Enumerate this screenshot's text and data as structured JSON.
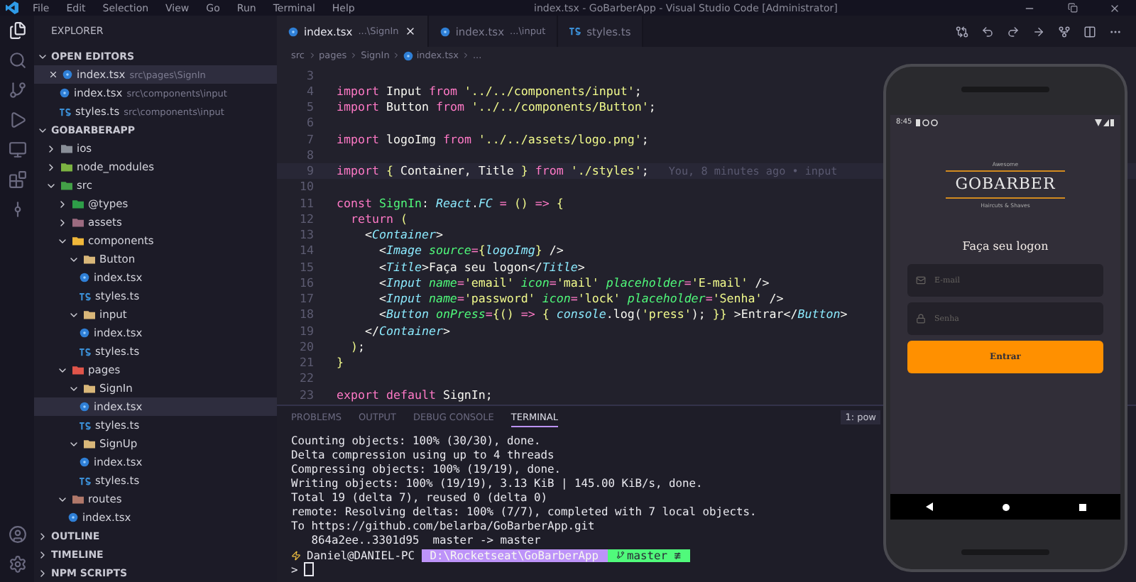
{
  "title_bar": {
    "menu": [
      "File",
      "Edit",
      "Selection",
      "View",
      "Go",
      "Run",
      "Terminal",
      "Help"
    ],
    "title": "index.tsx - GoBarberApp - Visual Studio Code [Administrator]"
  },
  "activity_bar": {
    "items": [
      {
        "kind": "files",
        "selected": true
      },
      {
        "kind": "search",
        "selected": false
      },
      {
        "kind": "scm",
        "selected": false
      },
      {
        "kind": "run",
        "selected": false
      },
      {
        "kind": "remote",
        "selected": false
      },
      {
        "kind": "extensions",
        "selected": false
      },
      {
        "kind": "git",
        "selected": false
      }
    ],
    "bottom": [
      {
        "kind": "account"
      },
      {
        "kind": "settings"
      }
    ]
  },
  "sidebar": {
    "title": "EXPLORER",
    "open_editors": {
      "title": "OPEN EDITORS",
      "expanded": true,
      "items": [
        {
          "name": "index.tsx",
          "path": "src\\pages\\SignIn",
          "kind": "react",
          "selected": true
        },
        {
          "name": "index.tsx",
          "path": "src\\components\\input",
          "kind": "react",
          "selected": false
        },
        {
          "name": "styles.ts",
          "path": "src\\components\\input",
          "kind": "ts",
          "selected": false
        }
      ]
    },
    "project": {
      "title": "GOBARBERAPP",
      "expanded": true,
      "tree": [
        {
          "name": "ios",
          "kind": "folder",
          "color": "#8a8f98",
          "expanded": false,
          "selected": false
        },
        {
          "name": "node_modules",
          "kind": "folder",
          "color": "#7cb342",
          "expanded": false,
          "selected": false
        },
        {
          "name": "src",
          "kind": "folder",
          "color": "#43a047",
          "expanded": true,
          "selected": false,
          "children": [
            {
              "name": "@types",
              "kind": "folder",
              "color": "#2e9e48",
              "expanded": false,
              "selected": false
            },
            {
              "name": "assets",
              "kind": "folder",
              "color": "#9c6b80",
              "expanded": false,
              "selected": false
            },
            {
              "name": "components",
              "kind": "folder",
              "color": "#f0b73a",
              "expanded": true,
              "selected": false,
              "children": [
                {
                  "name": "Button",
                  "kind": "folder",
                  "color": "#d9b779",
                  "expanded": true,
                  "selected": false,
                  "children": [
                    {
                      "name": "index.tsx",
                      "kind": "react",
                      "selected": false
                    },
                    {
                      "name": "styles.ts",
                      "kind": "ts",
                      "selected": false
                    }
                  ]
                },
                {
                  "name": "input",
                  "kind": "folder",
                  "color": "#d9b779",
                  "expanded": true,
                  "selected": false,
                  "children": [
                    {
                      "name": "index.tsx",
                      "kind": "react",
                      "selected": false
                    },
                    {
                      "name": "styles.ts",
                      "kind": "ts",
                      "selected": false
                    }
                  ]
                }
              ]
            },
            {
              "name": "pages",
              "kind": "folder",
              "color": "#e0554a",
              "expanded": true,
              "selected": false,
              "children": [
                {
                  "name": "SignIn",
                  "kind": "folder",
                  "color": "#d9b779",
                  "expanded": true,
                  "selected": false,
                  "children": [
                    {
                      "name": "index.tsx",
                      "kind": "react",
                      "selected": true
                    },
                    {
                      "name": "styles.ts",
                      "kind": "ts",
                      "selected": false
                    }
                  ]
                },
                {
                  "name": "SignUp",
                  "kind": "folder",
                  "color": "#d9b779",
                  "expanded": true,
                  "selected": false,
                  "children": [
                    {
                      "name": "index.tsx",
                      "kind": "react",
                      "selected": false
                    },
                    {
                      "name": "styles.ts",
                      "kind": "ts",
                      "selected": false
                    }
                  ]
                }
              ]
            },
            {
              "name": "routes",
              "kind": "folder",
              "color": "#b0786a",
              "expanded": true,
              "selected": false,
              "children": [
                {
                  "name": "index.tsx",
                  "kind": "react",
                  "selected": false
                }
              ]
            }
          ]
        }
      ]
    },
    "sections": [
      {
        "title": "OUTLINE",
        "expanded": false
      },
      {
        "title": "TIMELINE",
        "expanded": false
      },
      {
        "title": "NPM SCRIPTS",
        "expanded": false
      }
    ]
  },
  "editor": {
    "tabs": [
      {
        "name": "index.tsx",
        "path": "...\\SignIn",
        "kind": "react",
        "selected": true
      },
      {
        "name": "index.tsx",
        "path": "...\\input",
        "kind": "react",
        "selected": false
      },
      {
        "name": "styles.ts",
        "kind": "ts",
        "selected": false
      }
    ],
    "breadcrumb": [
      {
        "text": "src",
        "kind": "folder"
      },
      {
        "text": "pages",
        "kind": "folder"
      },
      {
        "text": "SignIn",
        "kind": "folder"
      },
      {
        "text": "index.tsx",
        "kind": "react"
      },
      {
        "text": "...",
        "kind": "symbol"
      }
    ],
    "lines": [
      {
        "number": "3"
      },
      {
        "number": "4",
        "tokens": [
          {
            "kind": "kw",
            "text": "import"
          },
          {
            "kind": "id",
            "text": " Input "
          },
          {
            "kind": "kw",
            "text": "from"
          },
          {
            "kind": "str",
            "text": " '../../components/input'"
          },
          {
            "kind": "id",
            "text": ";"
          }
        ]
      },
      {
        "number": "5",
        "tokens": [
          {
            "kind": "kw",
            "text": "import"
          },
          {
            "kind": "id",
            "text": " Button "
          },
          {
            "kind": "kw",
            "text": "from"
          },
          {
            "kind": "str",
            "text": " '../../components/Button'"
          },
          {
            "kind": "id",
            "text": ";"
          }
        ]
      },
      {
        "number": "6"
      },
      {
        "number": "7",
        "tokens": [
          {
            "kind": "kw",
            "text": "import"
          },
          {
            "kind": "id",
            "text": " logoImg "
          },
          {
            "kind": "kw",
            "text": "from"
          },
          {
            "kind": "str",
            "text": " '../../assets/logo.png'"
          },
          {
            "kind": "id",
            "text": ";"
          }
        ]
      },
      {
        "number": "8"
      },
      {
        "number": "9",
        "current": true,
        "blame": "You, 8 minutes ago • input",
        "tokens": [
          {
            "kind": "kw",
            "text": "import"
          },
          {
            "kind": "brace",
            "text": " {"
          },
          {
            "kind": "id",
            "text": " Container, Title "
          },
          {
            "kind": "brace",
            "text": "}"
          },
          {
            "kind": "kw",
            "text": " from"
          },
          {
            "kind": "str",
            "text": " './styles'"
          },
          {
            "kind": "id",
            "text": ";"
          }
        ]
      },
      {
        "number": "10"
      },
      {
        "number": "11",
        "tokens": [
          {
            "kind": "kw",
            "text": "const"
          },
          {
            "kind": "fn",
            "text": " SignIn"
          },
          {
            "kind": "id",
            "text": ": "
          },
          {
            "kind": "type",
            "text": "React"
          },
          {
            "kind": "id",
            "text": "."
          },
          {
            "kind": "type",
            "text": "FC"
          },
          {
            "kind": "kw",
            "text": " = "
          },
          {
            "kind": "brace",
            "text": "()"
          },
          {
            "kind": "kw",
            "text": " => "
          },
          {
            "kind": "brace",
            "text": "{"
          }
        ]
      },
      {
        "number": "12",
        "tokens": [
          {
            "kind": "kw",
            "text": "  return"
          },
          {
            "kind": "brace",
            "text": " ("
          }
        ]
      },
      {
        "number": "13",
        "tokens": [
          {
            "kind": "id",
            "text": "    <"
          },
          {
            "kind": "tag",
            "text": "Container"
          },
          {
            "kind": "id",
            "text": ">"
          }
        ]
      },
      {
        "number": "14",
        "tokens": [
          {
            "kind": "id",
            "text": "      <"
          },
          {
            "kind": "tag",
            "text": "Image"
          },
          {
            "kind": "attr",
            "text": " source"
          },
          {
            "kind": "kw",
            "text": "="
          },
          {
            "kind": "brace",
            "text": "{"
          },
          {
            "kind": "var",
            "text": "logoImg"
          },
          {
            "kind": "brace",
            "text": "}"
          },
          {
            "kind": "id",
            "text": " />"
          }
        ]
      },
      {
        "number": "15",
        "tokens": [
          {
            "kind": "id",
            "text": "      <"
          },
          {
            "kind": "tag",
            "text": "Title"
          },
          {
            "kind": "id",
            "text": ">Faça seu logon</"
          },
          {
            "kind": "tag",
            "text": "Title"
          },
          {
            "kind": "id",
            "text": ">"
          }
        ]
      },
      {
        "number": "16",
        "tokens": [
          {
            "kind": "id",
            "text": "      <"
          },
          {
            "kind": "tag",
            "text": "Input"
          },
          {
            "kind": "attr",
            "text": " name"
          },
          {
            "kind": "kw",
            "text": "="
          },
          {
            "kind": "str",
            "text": "'email'"
          },
          {
            "kind": "attr",
            "text": " icon"
          },
          {
            "kind": "kw",
            "text": "="
          },
          {
            "kind": "str",
            "text": "'mail'"
          },
          {
            "kind": "attr",
            "text": " placeholder"
          },
          {
            "kind": "kw",
            "text": "="
          },
          {
            "kind": "str",
            "text": "'E-mail'"
          },
          {
            "kind": "id",
            "text": " />"
          }
        ]
      },
      {
        "number": "17",
        "tokens": [
          {
            "kind": "id",
            "text": "      <"
          },
          {
            "kind": "tag",
            "text": "Input"
          },
          {
            "kind": "attr",
            "text": " name"
          },
          {
            "kind": "kw",
            "text": "="
          },
          {
            "kind": "str",
            "text": "'password'"
          },
          {
            "kind": "attr",
            "text": " icon"
          },
          {
            "kind": "kw",
            "text": "="
          },
          {
            "kind": "str",
            "text": "'lock'"
          },
          {
            "kind": "attr",
            "text": " placeholder"
          },
          {
            "kind": "kw",
            "text": "="
          },
          {
            "kind": "str",
            "text": "'Senha'"
          },
          {
            "kind": "id",
            "text": " />"
          }
        ]
      },
      {
        "number": "18",
        "tokens": [
          {
            "kind": "id",
            "text": "      <"
          },
          {
            "kind": "tag",
            "text": "Button"
          },
          {
            "kind": "attr",
            "text": " onPress"
          },
          {
            "kind": "kw",
            "text": "="
          },
          {
            "kind": "brace",
            "text": "{()"
          },
          {
            "kind": "kw",
            "text": " => "
          },
          {
            "kind": "brace",
            "text": "{"
          },
          {
            "kind": "var",
            "text": " console"
          },
          {
            "kind": "id",
            "text": ".log("
          },
          {
            "kind": "str",
            "text": "'press'"
          },
          {
            "kind": "id",
            "text": "); "
          },
          {
            "kind": "brace",
            "text": "}}"
          },
          {
            "kind": "id",
            "text": " >Entrar</"
          },
          {
            "kind": "tag",
            "text": "Button"
          },
          {
            "kind": "id",
            "text": ">"
          }
        ]
      },
      {
        "number": "19",
        "tokens": [
          {
            "kind": "id",
            "text": "    </"
          },
          {
            "kind": "tag",
            "text": "Container"
          },
          {
            "kind": "id",
            "text": ">"
          }
        ]
      },
      {
        "number": "20",
        "tokens": [
          {
            "kind": "brace",
            "text": "  )"
          },
          {
            "kind": "id",
            "text": ";"
          }
        ]
      },
      {
        "number": "21",
        "tokens": [
          {
            "kind": "brace",
            "text": "}"
          }
        ]
      },
      {
        "number": "22"
      },
      {
        "number": "23",
        "tokens": [
          {
            "kind": "kw",
            "text": "export"
          },
          {
            "kind": "kw",
            "text": " default"
          },
          {
            "kind": "id",
            "text": " SignIn;"
          }
        ]
      }
    ]
  },
  "panel": {
    "tabs": [
      {
        "label": "PROBLEMS",
        "selected": false
      },
      {
        "label": "OUTPUT",
        "selected": false
      },
      {
        "label": "DEBUG CONSOLE",
        "selected": false
      },
      {
        "label": "TERMINAL",
        "selected": true
      }
    ],
    "terminal_selector": "1: pow",
    "lines": [
      "Counting objects: 100% (30/30), done.",
      "Delta compression using up to 4 threads",
      "Compressing objects: 100% (19/19), done.",
      "Writing objects: 100% (19/19), 3.13 KiB | 145.00 KiB/s, done.",
      "Total 19 (delta 7), reused 0 (delta 0)",
      "remote: Resolving deltas: 100% (7/7), completed with 7 local objects.",
      "To https://github.com/belarba/GoBarberApp.git",
      "   864a2ee..3301d95  master -> master"
    ],
    "prompt": {
      "user": "Daniel@DANIEL-PC",
      "path": "D:\\Rocketseat\\GoBarberApp",
      "branch": "master ≢",
      "input_mark": ">"
    }
  },
  "phone": {
    "time": "8:45",
    "logo": {
      "top": "Awesome",
      "name": "GOBARBER",
      "bottom": "Haircuts & Shaves"
    },
    "title": "Faça seu logon",
    "inputs": [
      {
        "kind": "mail",
        "placeholder": "E-mail"
      },
      {
        "kind": "lock",
        "placeholder": "Senha"
      }
    ],
    "button": "Entrar"
  }
}
